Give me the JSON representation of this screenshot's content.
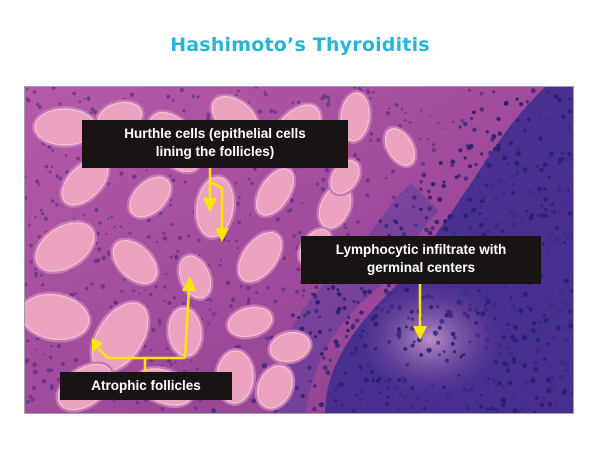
{
  "title": "Hashimoto’s Thyroiditis",
  "title_color": "#2ab4d6",
  "label_background": "#191413",
  "arrow_color": "#f6e600",
  "annotations": {
    "hurthle": [
      "Hurthle cells (epithelial cells",
      "lining the follicles)"
    ],
    "lymphocytic": [
      "Lymphocytic infiltrate with",
      "germinal centers"
    ],
    "atrophic": [
      "Atrophic follicles"
    ]
  }
}
